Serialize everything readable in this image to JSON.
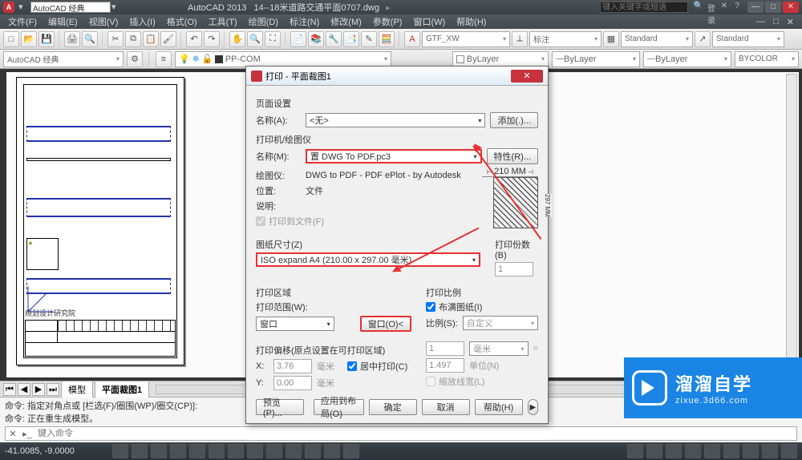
{
  "titlebar": {
    "workspace": "AutoCAD 经典",
    "app": "AutoCAD 2013",
    "doc": "14--18米道路交通平面0707.dwg",
    "search_placeholder": "键入关键字或短语",
    "login": "登录"
  },
  "menu": [
    "文件(F)",
    "编辑(E)",
    "视图(V)",
    "插入(I)",
    "格式(O)",
    "工具(T)",
    "绘图(D)",
    "标注(N)",
    "修改(M)",
    "参数(P)",
    "窗口(W)",
    "帮助(H)"
  ],
  "toolbar1": {
    "combo1": "GTF_XW",
    "combo2": "标注",
    "combo3": "Standard",
    "combo4": "Standard"
  },
  "toolbar2": {
    "workspace": "AutoCAD 经典",
    "layer": "PP-COM",
    "c1": "ByLayer",
    "c2": "ByLayer",
    "c3": "ByLayer",
    "c4": "BYCOLOR"
  },
  "tabs": {
    "model": "模型",
    "layout": "平面裁图1"
  },
  "cmd": {
    "line1": "命令: 指定对角点或 [栏选(F)/圈围(WP)/圈交(CP)]:",
    "line2": "命令: 正在重生成模型。",
    "placeholder": "键入命令"
  },
  "status": {
    "coords": "-41.0085, -9.0000"
  },
  "dialog": {
    "title": "打印 - 平面裁图1",
    "page_setup": "页面设置",
    "name_a": "名称(A):",
    "name_a_val": "<无>",
    "add": "添加(.)...",
    "printer": "打印机/绘图仪",
    "name_m": "名称(M):",
    "name_m_val": "置 DWG To PDF.pc3",
    "props": "特性(R)...",
    "plotter_l": "绘图仪:",
    "plotter_v": "DWG to PDF - PDF ePlot - by Autodesk",
    "loc_l": "位置:",
    "loc_v": "文件",
    "desc_l": "说明:",
    "to_file": "打印到文件(F)",
    "paper_size": "图纸尺寸(Z)",
    "paper_val": "ISO expand A4 (210.00 x 297.00 毫米)",
    "copies": "打印份数(B)",
    "copies_v": "1",
    "area": "打印区域",
    "range": "打印范围(W):",
    "range_v": "窗口",
    "window_btn": "窗口(O)<",
    "scale": "打印比例",
    "fit": "布满图纸(I)",
    "scale_l": "比例(S):",
    "scale_v": "自定义",
    "offset": "打印偏移(原点设置在可打印区域)",
    "x": "X:",
    "x_v": "3.76",
    "y": "Y:",
    "y_v": "0.00",
    "mm": "毫米",
    "center": "居中打印(C)",
    "unit1": "1",
    "unit_mm": "毫米",
    "unit2": "1.497",
    "unit_u": "单位(N)",
    "scale_lw": "缩放线宽(L)",
    "preview": "预览(P)...",
    "apply": "应用到布局(O)",
    "ok": "确定",
    "cancel": "取消",
    "help": "帮助(H)",
    "pv_w": "210 MM",
    "pv_h": "297 MM"
  },
  "watermark": {
    "title": "溜溜自学",
    "sub": "zixue.3d66.com"
  },
  "paper_label": "规划设计研究院"
}
